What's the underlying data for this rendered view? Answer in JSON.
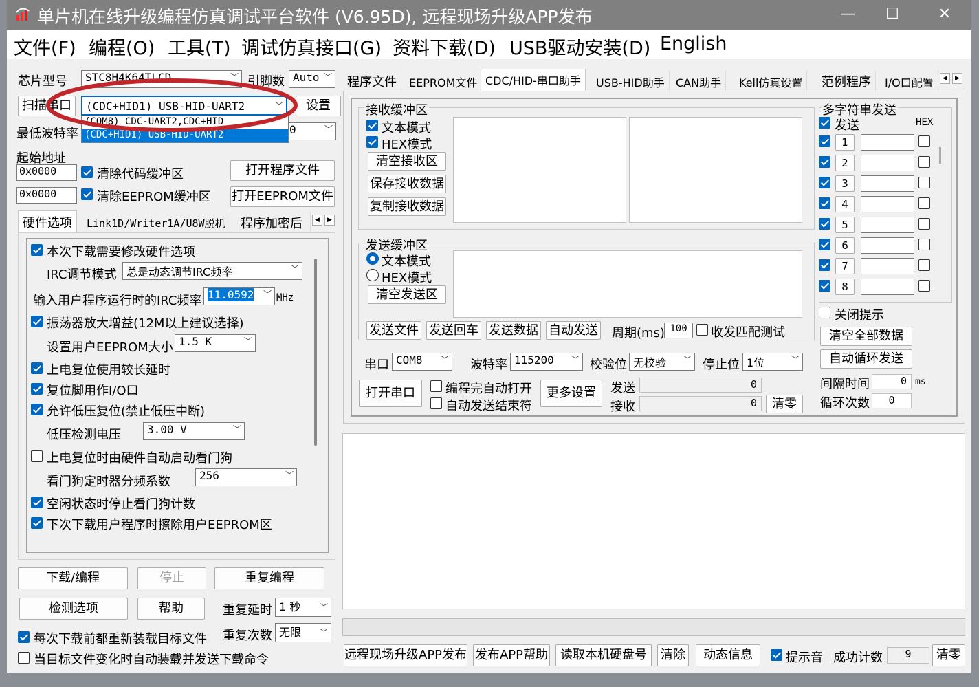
{
  "window": {
    "title": "单片机在线升级编程仿真调试平台软件 (V6.95D), 远程现场升级APP发布",
    "minimize": "—",
    "maximize": "☐",
    "close": "✕"
  },
  "menu": [
    "文件(F)",
    "编程(O)",
    "工具(T)",
    "调试仿真接口(G)",
    "资料下载(D)",
    "USB驱动安装(D)",
    "English"
  ],
  "left": {
    "chip_label": "芯片型号",
    "chip_value": "STC8H4K64TLCD",
    "pin_label": "引脚数",
    "pin_value": "Auto",
    "scan_button": "扫描串口",
    "port_value": "(CDC+HID1) USB-HID-UART2",
    "port_options": [
      "(COM8) CDC-UART2,CDC+HID",
      "(CDC+HID1) USB-HID-UART2"
    ],
    "settings_button": "设置",
    "min_baud_label": "最低波特率",
    "min_baud_partial": "0",
    "start_addr_label": "起始地址",
    "addr1": "0x0000",
    "addr2": "0x0000",
    "clear_code_label": "清除代码缓冲区",
    "clear_eeprom_label": "清除EEPROM缓冲区",
    "open_program_button": "打开程序文件",
    "open_eeprom_button": "打开EEPROM文件",
    "tabs": [
      "硬件选项",
      "Link1D/Writer1A/U8W脱机",
      "程序加密后"
    ],
    "options": {
      "modify_hw": "本次下载需要修改硬件选项",
      "irc_mode_label": "IRC调节模式",
      "irc_mode_value": "总是动态调节IRC频率",
      "irc_freq_label": "输入用户程序运行时的IRC频率",
      "irc_freq_value": "11.0592",
      "mhz": "MHz",
      "osc_gain": "振荡器放大增益(12M以上建议选择)",
      "eeprom_size_label": "设置用户EEPROM大小",
      "eeprom_size_value": "1.5 K",
      "long_delay": "上电复位使用较长延时",
      "reset_io": "复位脚用作I/O口",
      "low_volt_reset": "允许低压复位(禁止低压中断)",
      "low_volt_label": "低压检测电压",
      "low_volt_value": "3.00 V",
      "watchdog_auto": "上电复位时由硬件自动启动看门狗",
      "wd_div_label": "看门狗定时器分频系数",
      "wd_div_value": "256",
      "idle_stop_wd": "空闲状态时停止看门狗计数",
      "erase_eeprom": "下次下载用户程序时擦除用户EEPROM区"
    },
    "download_button": "下载/编程",
    "stop_button": "停止",
    "reprogram_button": "重复编程",
    "detect_button": "检测选项",
    "help_button": "帮助",
    "repeat_delay_label": "重复延时",
    "repeat_delay_value": "1 秒",
    "repeat_count_label": "重复次数",
    "repeat_count_value": "无限",
    "reload_each": "每次下载前都重新装载目标文件",
    "auto_reload": "当目标文件变化时自动装载并发送下载命令"
  },
  "right": {
    "tabs": [
      "程序文件",
      "EEPROM文件",
      "CDC/HID-串口助手",
      "USB-HID助手",
      "CAN助手",
      "Keil仿真设置",
      "范例程序",
      "I/O口配置"
    ],
    "recv": {
      "title": "接收缓冲区",
      "text_mode": "文本模式",
      "hex_mode": "HEX模式",
      "clear": "清空接收区",
      "save": "保存接收数据",
      "copy": "复制接收数据"
    },
    "send": {
      "title": "发送缓冲区",
      "text_mode": "文本模式",
      "hex_mode": "HEX模式",
      "clear": "清空发送区",
      "send_file": "发送文件",
      "send_cr": "发送回车",
      "send_data": "发送数据",
      "auto_send": "自动发送",
      "period_label": "周期(ms)",
      "period_value": "100",
      "match_test": "收发匹配测试"
    },
    "port_label": "串口",
    "port_value": "COM8",
    "baud_label": "波特率",
    "baud_value": "115200",
    "parity_label": "校验位",
    "parity_value": "无校验",
    "stop_label": "停止位",
    "stop_value": "1位",
    "open_port": "打开串口",
    "auto_open": "编程完自动打开",
    "auto_end": "自动发送结束符",
    "more_settings": "更多设置",
    "send_label": "发送",
    "send_count": "0",
    "recv_label": "接收",
    "recv_count": "0",
    "clear_zero": "清零",
    "multi": {
      "title": "多字符串发送",
      "send_col": "发送",
      "hex_col": "HEX",
      "rows": [
        "1",
        "2",
        "3",
        "4",
        "5",
        "6",
        "7",
        "8"
      ],
      "close_hint": "关闭提示",
      "clear_all": "清空全部数据",
      "auto_loop": "自动循环发送",
      "interval_label": "间隔时间",
      "interval_value": "0",
      "interval_unit": "ms",
      "loop_label": "循环次数",
      "loop_value": "0"
    }
  },
  "bottom": {
    "remote_publish": "远程现场升级APP发布",
    "publish_help": "发布APP帮助",
    "read_disk": "读取本机硬盘号",
    "clear": "清除",
    "dynamic_info": "动态信息",
    "beep": "提示音",
    "success_label": "成功计数",
    "success_value": "9",
    "clear_zero": "清零"
  },
  "annotation_color": "#c0262a"
}
